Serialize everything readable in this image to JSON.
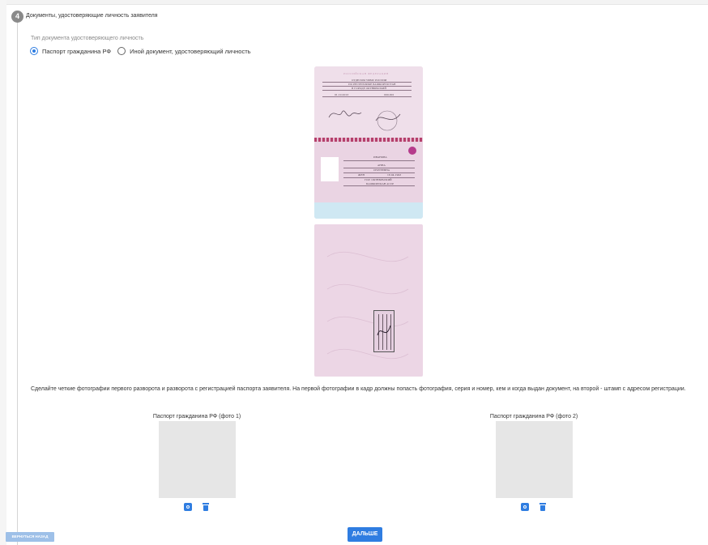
{
  "step": {
    "number": "4",
    "title": "Документы, удостоверяющие личность заявителя"
  },
  "document_type": {
    "label": "Тип документа удостоверяющего личность",
    "options": [
      {
        "label": "Паспорт гражданина РФ",
        "selected": true
      },
      {
        "label": "Иной документ, удостоверяющий личность",
        "selected": false
      }
    ]
  },
  "sample_passport": {
    "header": "РОССИЙСКАЯ ФЕДЕРАЦИЯ",
    "issued_by_line1": "ОТДЕЛОМ УФМС РОССИИ",
    "issued_by_line2": "ПО РЕСПУБЛИКЕ БАШКОРТОСТАН",
    "issued_by_line3": "В ГОРОДЕ ОКТЯБРЬСКИЙ",
    "issue_date": "01.10.2013",
    "code": "000-001",
    "surname": "ИВАНОВА",
    "name": "АННА",
    "patronymic": "СЕРГЕЕВНА",
    "sex": "ЖЕН",
    "birth_date": "18.04.1993",
    "birth_place_line1": "ГОР. ОКТЯБРЬСКИЙ",
    "birth_place_line2": "БАШКИРСКАЯ АССР"
  },
  "instructions": "Сделайте четкие фотографии первого разворота и разворота с регистрацией паспорта заявителя. На первой фотографии в кадр должны попасть фотография, серия и номер, кем и когда выдан документ, на второй - штамп с адресом регистрации.",
  "photos": [
    {
      "label": "Паспорт гражданина РФ (фото 1)"
    },
    {
      "label": "Паспорт гражданина РФ (фото 2)"
    }
  ],
  "buttons": {
    "back": "ВЕРНУТЬСЯ НАЗАД",
    "next": "ДАЛЬШЕ"
  },
  "colors": {
    "accent": "#2f7de1",
    "placeholder": "#e6e6e6"
  }
}
